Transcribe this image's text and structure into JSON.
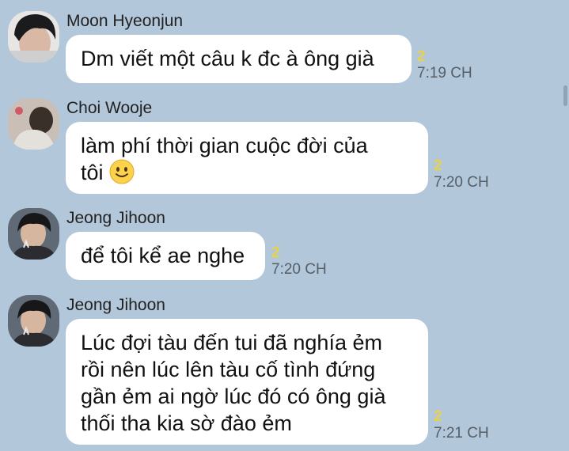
{
  "messages": [
    {
      "sender": "Moon Hyeonjun",
      "text": "Dm viết một câu k đc à ông già",
      "unread": "2",
      "time": "7:19 CH",
      "avatar": "avatar-photo"
    },
    {
      "sender": "Choi Wooje",
      "text_line1": "làm phí thời gian cuộc đời của",
      "text_line2": "tôi",
      "emoji": "slightly-smiling-face-icon",
      "unread": "2",
      "time": "7:20 CH",
      "avatar": "avatar-photo"
    },
    {
      "sender": "Jeong Jihoon",
      "text": "để tôi kể ae nghe",
      "unread": "2",
      "time": "7:20 CH",
      "avatar": "avatar-photo"
    },
    {
      "sender": "Jeong Jihoon",
      "lines": [
        "Lúc đợi tàu đến tui đã nghía ẻm",
        "rồi nên lúc lên tàu cố tình đứng",
        "gần ẻm ai ngờ lúc đó có ông già",
        "thối tha kia sờ đào ẻm"
      ],
      "unread": "2",
      "time": "7:21 CH",
      "avatar": "avatar-photo"
    }
  ],
  "colors": {
    "background": "#b2c7da",
    "bubble": "#ffffff",
    "unread": "#e9d24a",
    "time": "#565e66"
  }
}
